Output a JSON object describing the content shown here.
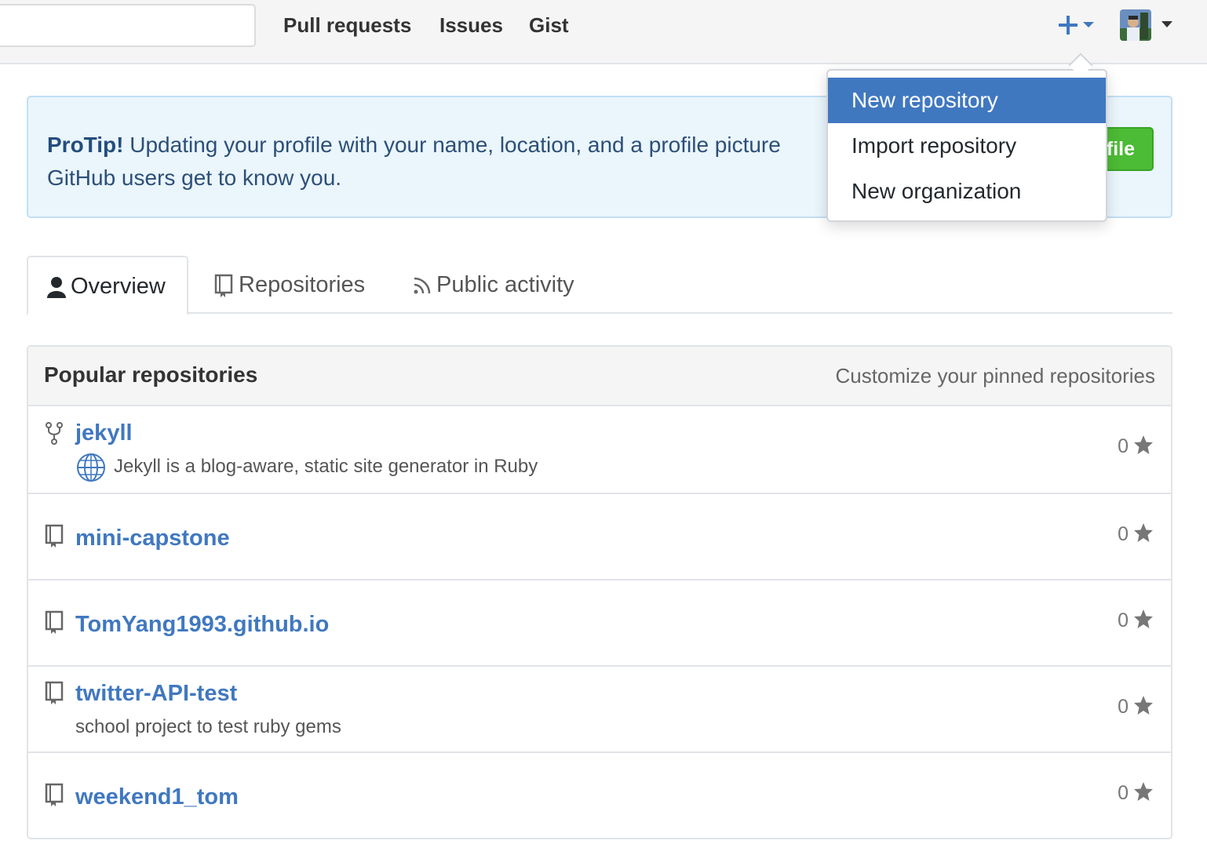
{
  "header": {
    "nav": [
      "Pull requests",
      "Issues",
      "Gist"
    ]
  },
  "dropdown": {
    "items": [
      "New repository",
      "Import repository",
      "New organization"
    ]
  },
  "protip": {
    "label": "ProTip!",
    "text_line1": " Updating your profile with your name, location, and a profile picture",
    "text_line2": "GitHub users get to know you.",
    "button": "file"
  },
  "tabs": [
    {
      "label": "Overview",
      "icon": "person-icon"
    },
    {
      "label": "Repositories",
      "icon": "repo-icon"
    },
    {
      "label": "Public activity",
      "icon": "rss-icon"
    }
  ],
  "popular": {
    "title": "Popular repositories",
    "action": "Customize your pinned repositories",
    "repos": [
      {
        "name": "jekyll",
        "description": "Jekyll is a blog-aware, static site generator in Ruby",
        "stars": "0",
        "icon": "fork-icon"
      },
      {
        "name": "mini-capstone",
        "description": "",
        "stars": "0",
        "icon": "repo-icon"
      },
      {
        "name": "TomYang1993.github.io",
        "description": "",
        "stars": "0",
        "icon": "repo-icon"
      },
      {
        "name": "twitter-API-test",
        "description": "school project to test ruby gems",
        "stars": "0",
        "icon": "repo-icon"
      },
      {
        "name": "weekend1_tom",
        "description": "",
        "stars": "0",
        "icon": "repo-icon"
      }
    ]
  },
  "colors": {
    "link": "#4078c0",
    "dropdown_active": "#4078c0",
    "protip_bg": "#eaf5fc",
    "green_button": "#4cbb35"
  }
}
